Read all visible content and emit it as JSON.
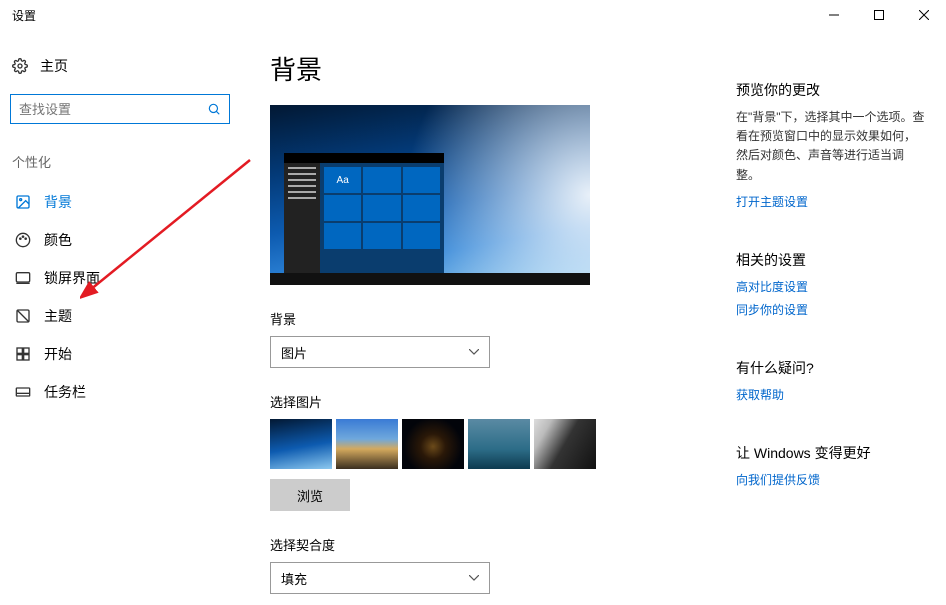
{
  "window": {
    "title": "设置"
  },
  "sidebar": {
    "home": "主页",
    "search_placeholder": "查找设置",
    "section": "个性化",
    "items": [
      {
        "label": "背景"
      },
      {
        "label": "颜色"
      },
      {
        "label": "锁屏界面"
      },
      {
        "label": "主题"
      },
      {
        "label": "开始"
      },
      {
        "label": "任务栏"
      }
    ]
  },
  "main": {
    "title": "背景",
    "preview_sample": "Aa",
    "bg_label": "背景",
    "bg_value": "图片",
    "pick_label": "选择图片",
    "browse": "浏览",
    "fit_label": "选择契合度",
    "fit_value": "填充"
  },
  "right": {
    "preview": {
      "heading": "预览你的更改",
      "text": "在\"背景\"下，选择其中一个选项。查看在预览窗口中的显示效果如何，然后对颜色、声音等进行适当调整。",
      "link": "打开主题设置"
    },
    "related": {
      "heading": "相关的设置",
      "link1": "高对比度设置",
      "link2": "同步你的设置"
    },
    "help": {
      "heading": "有什么疑问?",
      "link": "获取帮助"
    },
    "feedback": {
      "heading": "让 Windows 变得更好",
      "link": "向我们提供反馈"
    }
  }
}
